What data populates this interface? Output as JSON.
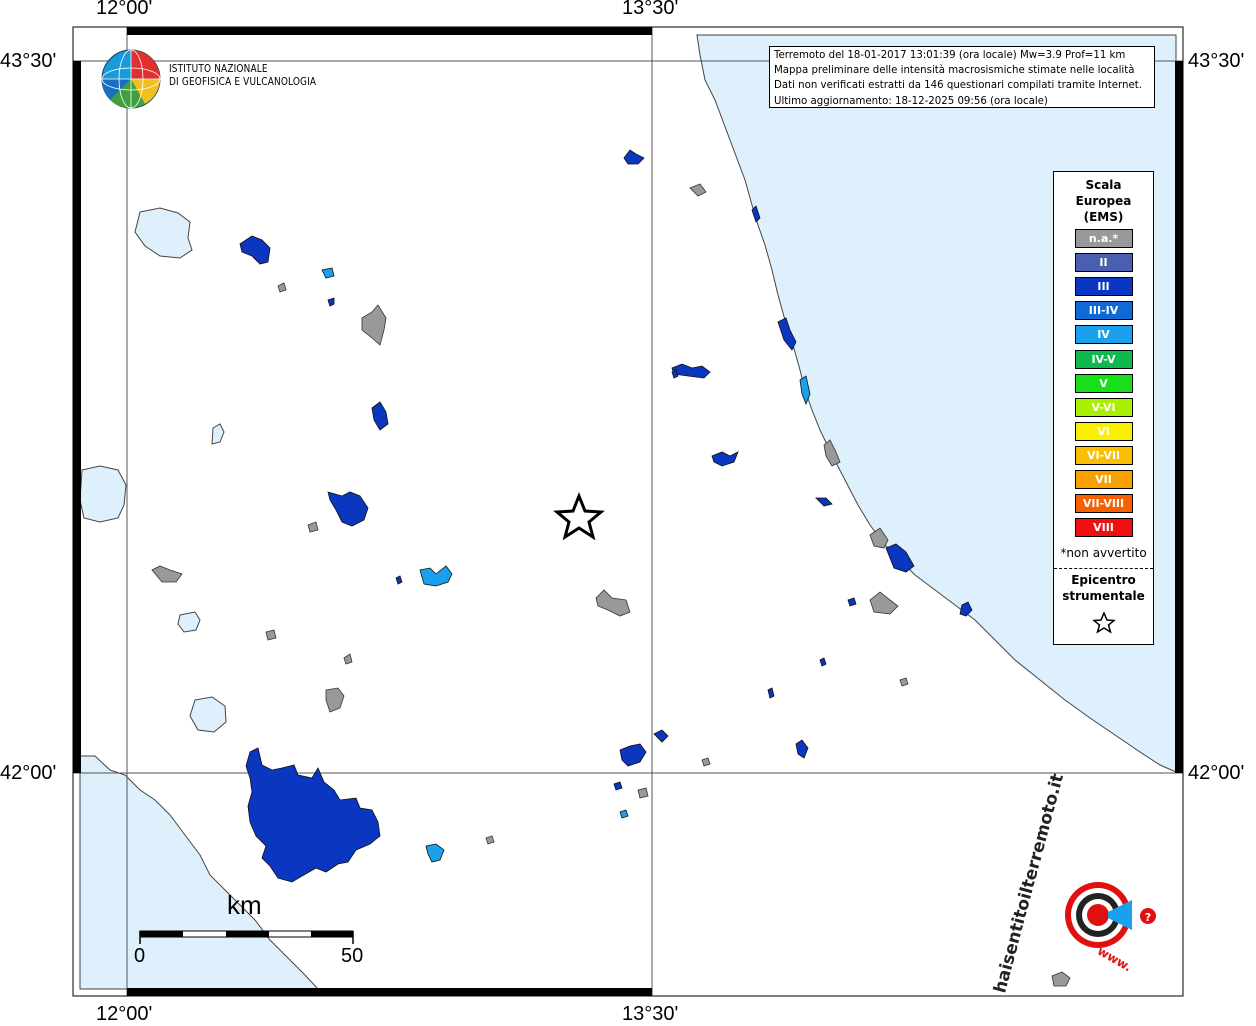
{
  "coords": {
    "top_left": "12°00'",
    "top_mid": "13°30'",
    "bottom_left": "12°00'",
    "bottom_mid": "13°30'",
    "left_top": "43°30'",
    "left_bottom": "42°00'",
    "right_top": "43°30'",
    "right_bottom": "42°00'"
  },
  "logo": {
    "line1": "ISTITUTO NAZIONALE",
    "line2": "DI GEOFISICA E VULCANOLOGIA"
  },
  "info": {
    "line1": "Terremoto del 18-01-2017 13:01:39 (ora locale) Mw=3.9 Prof=11 km",
    "line2": "Mappa preliminare delle intensità macrosismiche stimate nelle località",
    "line3": "Dati non verificati estratti da 146 questionari compilati tramite Internet.",
    "line4": "Ultimo aggiornamento: 18-12-2025 09:56 (ora locale)"
  },
  "legend": {
    "title1": "Scala",
    "title2": "Europea",
    "title3": "(EMS)",
    "items": [
      {
        "label": "n.a.*",
        "color": "#999999"
      },
      {
        "label": "II",
        "color": "#4a5fb0"
      },
      {
        "label": "III",
        "color": "#0a36c0"
      },
      {
        "label": "III-IV",
        "color": "#0f6ad8"
      },
      {
        "label": "IV",
        "color": "#1aa0ec"
      },
      {
        "label": "IV-V",
        "color": "#10b850"
      },
      {
        "label": "V",
        "color": "#18e018"
      },
      {
        "label": "V-VI",
        "color": "#a8f000"
      },
      {
        "label": "VI",
        "color": "#f8f000"
      },
      {
        "label": "VI-VII",
        "color": "#f8c000"
      },
      {
        "label": "VII",
        "color": "#f8a000"
      },
      {
        "label": "VII-VIII",
        "color": "#f86000"
      },
      {
        "label": "VIII",
        "color": "#f01010"
      }
    ],
    "note": "*non avvertito",
    "epi1": "Epicentro",
    "epi2": "strumentale"
  },
  "scalebar": {
    "unit": "km",
    "start": "0",
    "end": "50"
  },
  "watermark": {
    "text": "haisentitoilterremoto.it",
    "www": "www."
  },
  "colors": {
    "sea": "#dff0fd",
    "na": "#999999",
    "III": "#0a36c0",
    "IV": "#1aa0ec"
  }
}
